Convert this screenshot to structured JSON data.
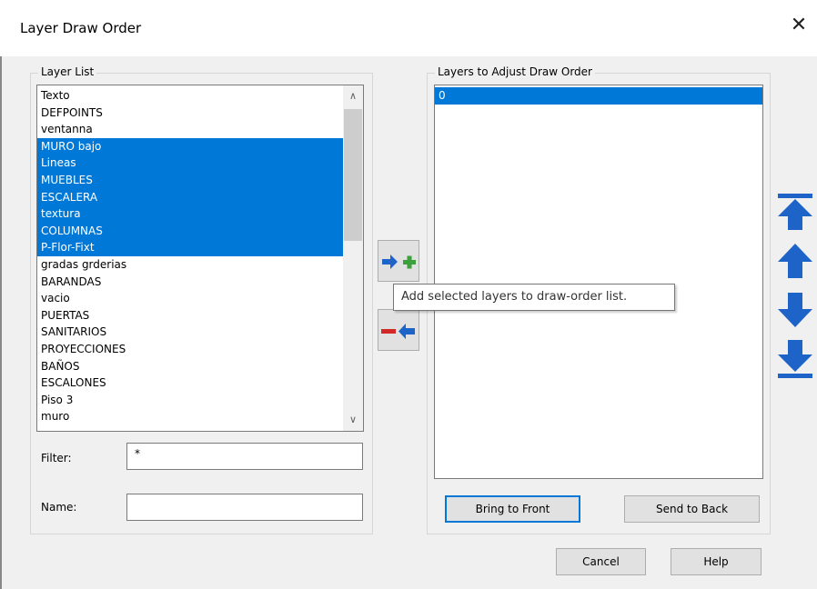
{
  "window": {
    "title": "Layer Draw Order"
  },
  "layer_list": {
    "legend": "Layer List",
    "items": [
      {
        "label": "Texto",
        "selected": false
      },
      {
        "label": "DEFPOINTS",
        "selected": false
      },
      {
        "label": "ventanna",
        "selected": false
      },
      {
        "label": "MURO bajo",
        "selected": true
      },
      {
        "label": "Lineas",
        "selected": true
      },
      {
        "label": "MUEBLES",
        "selected": true
      },
      {
        "label": "ESCALERA",
        "selected": true
      },
      {
        "label": "textura",
        "selected": true
      },
      {
        "label": "COLUMNAS",
        "selected": true
      },
      {
        "label": "P-Flor-Fixt",
        "selected": true
      },
      {
        "label": "gradas grderias",
        "selected": false
      },
      {
        "label": "BARANDAS",
        "selected": false
      },
      {
        "label": "vacio",
        "selected": false
      },
      {
        "label": "PUERTAS",
        "selected": false
      },
      {
        "label": "SANITARIOS",
        "selected": false
      },
      {
        "label": "PROYECCIONES",
        "selected": false
      },
      {
        "label": "BAÑOS",
        "selected": false
      },
      {
        "label": "ESCALONES",
        "selected": false
      },
      {
        "label": "Piso 3",
        "selected": false
      },
      {
        "label": "muro",
        "selected": false
      }
    ]
  },
  "filter": {
    "label": "Filter:",
    "value": "*"
  },
  "name": {
    "label": "Name:",
    "value": ""
  },
  "draw_order": {
    "legend": "Layers to Adjust Draw Order",
    "items": [
      {
        "label": "0",
        "selected": true
      }
    ],
    "bring_front_label": "Bring to Front",
    "send_back_label": "Send to Back"
  },
  "tooltip": "Add selected layers to draw-order list.",
  "buttons": {
    "cancel": "Cancel",
    "help": "Help"
  },
  "colors": {
    "selection": "#0078d7",
    "arrow_blue": "#1e64c8",
    "add_green": "#3ca03c",
    "remove_red": "#d22828"
  }
}
